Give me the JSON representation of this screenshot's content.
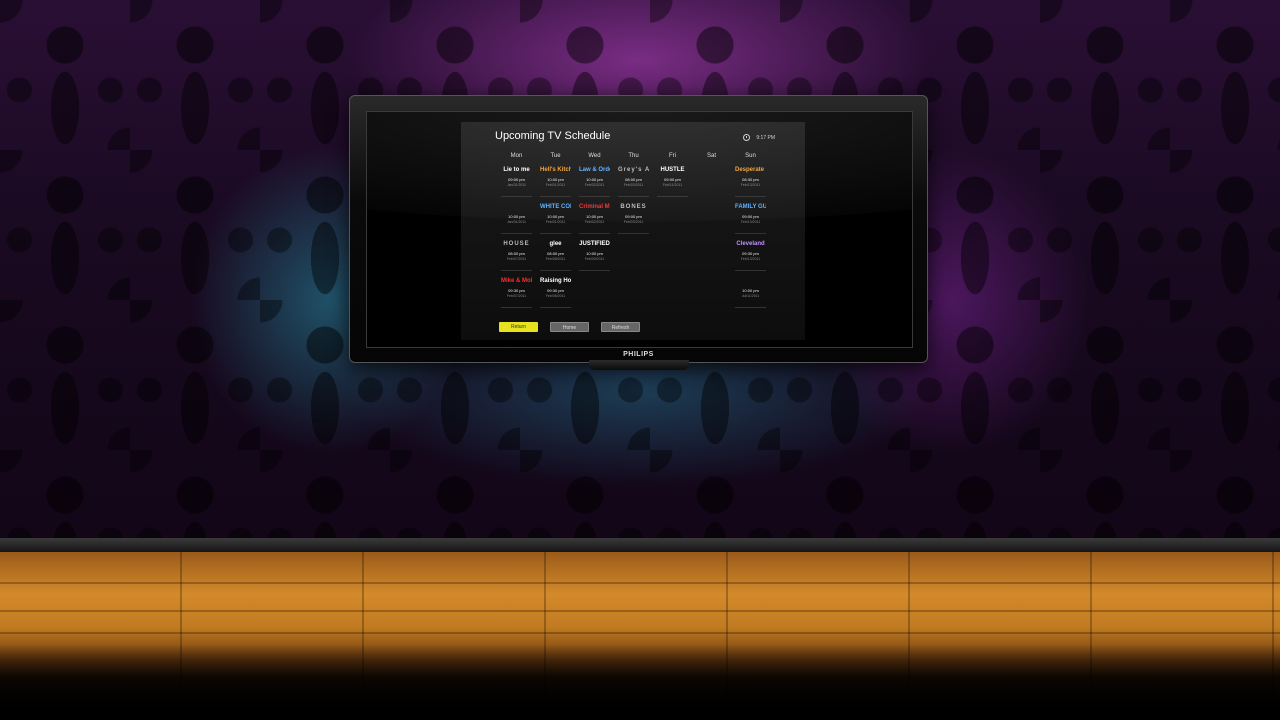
{
  "tv": {
    "brand": "PHILIPS"
  },
  "app": {
    "title": "Upcoming TV Schedule",
    "clock": "9:17 PM",
    "days": [
      "Mon",
      "Tue",
      "Wed",
      "Thu",
      "Fri",
      "Sat",
      "Sun"
    ],
    "rows": [
      [
        {
          "show": "Lie to me",
          "style": "white",
          "time": "09:00 pm",
          "date": "Jan/31/2011"
        },
        {
          "show": "Hell's Kitchen",
          "style": "orange",
          "time": "10:00 pm",
          "date": "Feb/01/2011"
        },
        {
          "show": "Law & Order",
          "style": "blue",
          "time": "10:00 pm",
          "date": "Feb/02/2011"
        },
        {
          "show": "Grey's Anatomy",
          "style": "gray",
          "time": "08:00 pm",
          "date": "Feb/03/2011"
        },
        {
          "show": "HUSTLE",
          "style": "white",
          "time": "09:00 pm",
          "date": "Feb/11/2011"
        },
        null,
        {
          "show": "Desperate Housewives",
          "style": "orange",
          "time": "08:30 pm",
          "date": "Feb/13/2011"
        }
      ],
      [
        {
          "show": "",
          "style": "white",
          "time": "10:00 pm",
          "date": "Jan/31/2011"
        },
        {
          "show": "WHITE COLLAR",
          "style": "blue",
          "time": "10:00 pm",
          "date": "Feb/01/2011"
        },
        {
          "show": "Criminal Minds",
          "style": "red",
          "time": "10:00 pm",
          "date": "Feb/02/2011"
        },
        {
          "show": "BONES",
          "style": "gray",
          "time": "09:00 pm",
          "date": "Feb/03/2011"
        },
        null,
        null,
        {
          "show": "FAMILY GUY",
          "style": "blue",
          "time": "09:00 pm",
          "date": "Feb/13/2011"
        }
      ],
      [
        {
          "show": "HOUSE",
          "style": "gray",
          "time": "08:00 pm",
          "date": "Feb/07/2011"
        },
        {
          "show": "glee",
          "style": "white",
          "time": "08:00 pm",
          "date": "Feb/08/2011"
        },
        {
          "show": "JUSTIFIED",
          "style": "white",
          "time": "10:00 pm",
          "date": "Feb/09/2011"
        },
        null,
        null,
        null,
        {
          "show": "Cleveland",
          "style": "purple",
          "time": "09:30 pm",
          "date": "Feb/13/2011"
        }
      ],
      [
        {
          "show": "Mike & Molly",
          "style": "red",
          "time": "09:30 pm",
          "date": "Feb/07/2011"
        },
        {
          "show": "Raising Hope",
          "style": "white",
          "time": "09:30 pm",
          "date": "Feb/08/2011"
        },
        null,
        null,
        null,
        null,
        {
          "show": "",
          "style": "white",
          "time": "10:00 pm",
          "date": "Jul/11/2011"
        }
      ]
    ],
    "buttons": {
      "return": "Return",
      "home": "Home",
      "refresh": "Refresh"
    }
  }
}
